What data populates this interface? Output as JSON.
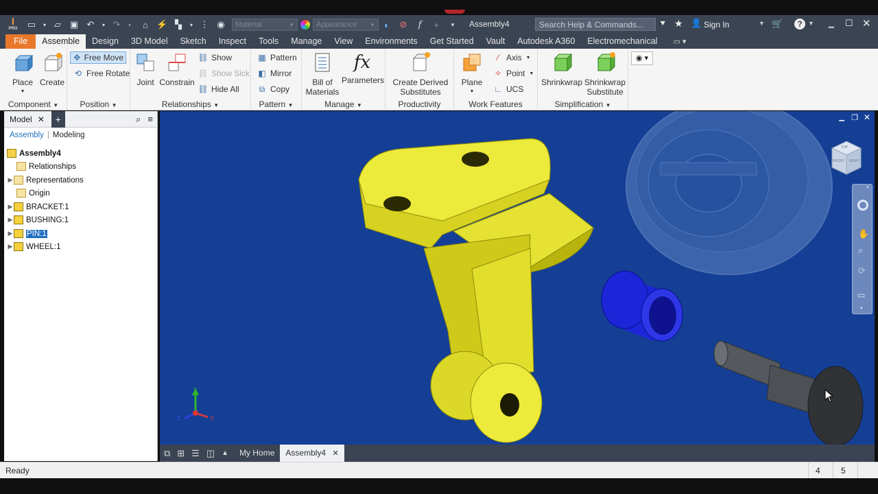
{
  "title_bar": {
    "material_placeholder": "Material",
    "appearance_placeholder": "Appearance",
    "document_name": "Assembly4",
    "search_placeholder": "Search Help & Commands...",
    "sign_in": "Sign In",
    "app_logo_text": "I",
    "app_logo_sub": "PRO"
  },
  "menu": [
    "File",
    "Assemble",
    "Design",
    "3D Model",
    "Sketch",
    "Inspect",
    "Tools",
    "Manage",
    "View",
    "Environments",
    "Get Started",
    "Vault",
    "Autodesk A360",
    "Electromechanical"
  ],
  "ribbon": {
    "component": {
      "title": "Component",
      "place": "Place",
      "create": "Create"
    },
    "position": {
      "title": "Position",
      "free_move": "Free Move",
      "free_rotate": "Free Rotate"
    },
    "relationships": {
      "title": "Relationships",
      "joint": "Joint",
      "constrain": "Constrain",
      "show": "Show",
      "show_sick": "Show Sick",
      "hide_all": "Hide All"
    },
    "pattern": {
      "title": "Pattern",
      "pattern": "Pattern",
      "mirror": "Mirror",
      "copy": "Copy"
    },
    "manage": {
      "title": "Manage",
      "bom_line1": "Bill of",
      "bom_line2": "Materials",
      "parameters": "Parameters"
    },
    "productivity": {
      "title": "Productivity",
      "derived_line1": "Create Derived",
      "derived_line2": "Substitutes"
    },
    "work_features": {
      "title": "Work Features",
      "plane": "Plane",
      "axis": "Axis",
      "point": "Point",
      "ucs": "UCS"
    },
    "simplification": {
      "title": "Simplification",
      "shrinkwrap": "Shrinkwrap",
      "shrinkwrap_sub_line1": "Shrinkwrap",
      "shrinkwrap_sub_line2": "Substitute"
    }
  },
  "browser": {
    "tab": "Model",
    "sub_tabs": [
      "Assembly",
      "Modeling"
    ],
    "root": "Assembly4",
    "items": [
      {
        "label": "Relationships",
        "type": "folder"
      },
      {
        "label": "Representations",
        "type": "rep"
      },
      {
        "label": "Origin",
        "type": "folder"
      },
      {
        "label": "BRACKET:1",
        "type": "part"
      },
      {
        "label": "BUSHING:1",
        "type": "part"
      },
      {
        "label": "PIN:1",
        "type": "part"
      },
      {
        "label": "WHEEL:1",
        "type": "part"
      }
    ]
  },
  "viewcube": {
    "front": "FRONT",
    "right": "RIGHT",
    "top": "TOP"
  },
  "doc_tabs": {
    "home": "My Home",
    "assembly": "Assembly4"
  },
  "status": {
    "text": "Ready",
    "count_a": "4",
    "count_b": "5"
  },
  "axis": {
    "x": "X",
    "y": "Y",
    "z": "Z"
  },
  "colors": {
    "viewport_bg": "#143f95",
    "bracket": "#e3df2b",
    "bushing": "#1c25d8",
    "pin": "#4a4d52",
    "accent": "#e9782b"
  }
}
